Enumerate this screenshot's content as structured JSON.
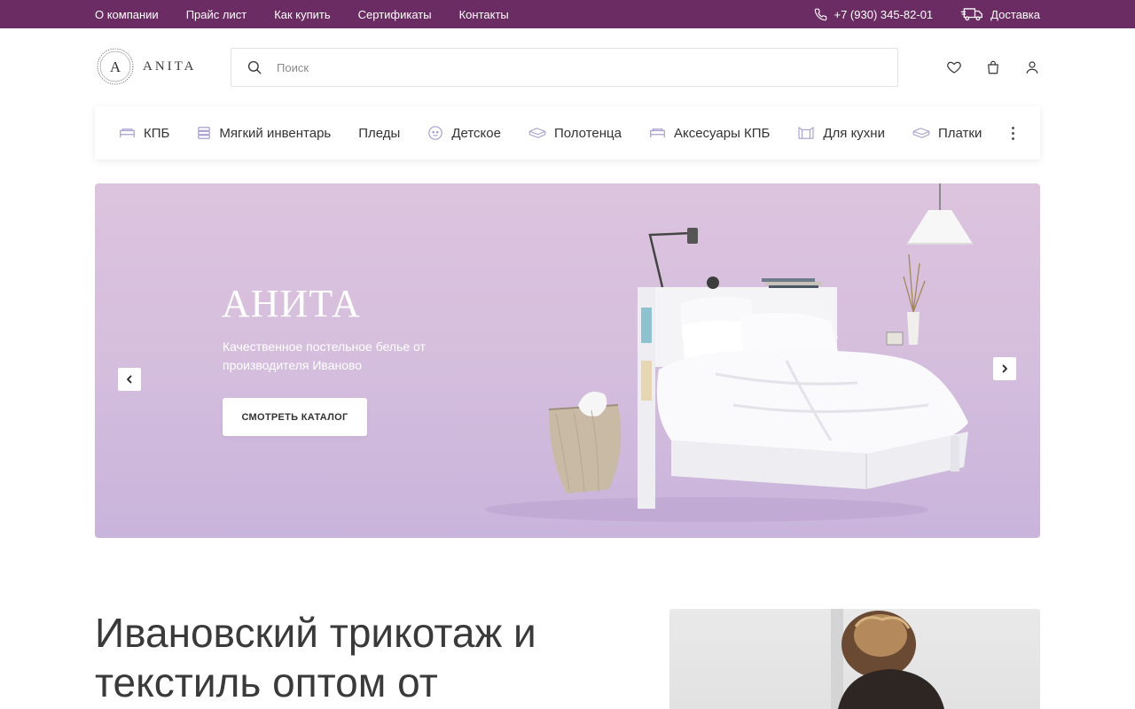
{
  "topbar": {
    "links": [
      "О компании",
      "Прайс лист",
      "Как купить",
      "Сертификаты",
      "Контакты"
    ],
    "phone": "+7 (930) 345-82-01",
    "delivery": "Доставка",
    "background": "#6a2c62"
  },
  "header": {
    "logo_text": "ANITA",
    "search_placeholder": "Поиск",
    "icons": [
      "heart-icon",
      "bag-icon",
      "user-icon"
    ]
  },
  "categories": [
    {
      "label": "КПБ",
      "icon": "bed-icon"
    },
    {
      "label": "Мягкий инвентарь",
      "icon": "stack-icon"
    },
    {
      "label": "Пледы",
      "icon": ""
    },
    {
      "label": "Детское",
      "icon": "baby-icon"
    },
    {
      "label": "Полотенца",
      "icon": "towel-icon"
    },
    {
      "label": "Аксесуары КПБ",
      "icon": "bed-icon"
    },
    {
      "label": "Для кухни",
      "icon": "apron-icon"
    },
    {
      "label": "Платки",
      "icon": "towel-icon"
    }
  ],
  "hero": {
    "title": "АНИТА",
    "subtitle": "Качественное постельное белье от производителя Иваново",
    "button": "СМОТРЕТЬ КАТАЛОГ"
  },
  "section": {
    "headline": "Ивановский трикотаж и текстиль оптом от"
  },
  "colors": {
    "accent": "#6a2c62",
    "hero_bg": "#d6bfdd",
    "icon_accent": "#a99fd0"
  }
}
